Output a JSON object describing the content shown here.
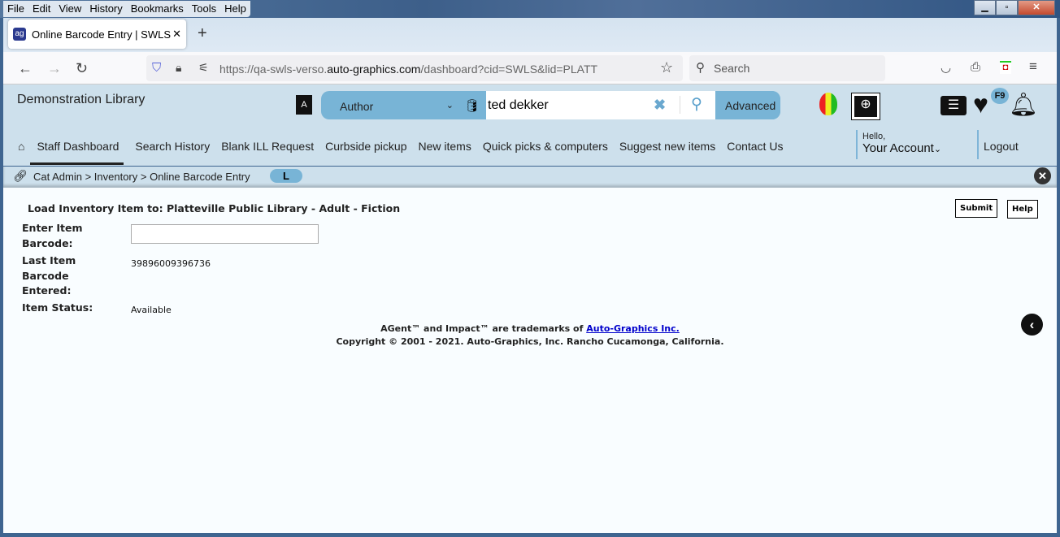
{
  "browser": {
    "menu": [
      "File",
      "Edit",
      "View",
      "History",
      "Bookmarks",
      "Tools",
      "Help"
    ],
    "tab_title": "Online Barcode Entry | SWLS | pl",
    "url_prefix": "https://qa-swls-verso.",
    "url_domain": "auto-graphics.com",
    "url_path": "/dashboard?cid=SWLS&lid=PLATT",
    "search_placeholder": "Search"
  },
  "app": {
    "library_name": "Demonstration Library",
    "search_type": "Author",
    "search_value": "ted dekker",
    "advanced_label": "Advanced",
    "badge": "F9",
    "nav": [
      "Staff Dashboard",
      "Search History",
      "Blank ILL Request",
      "Curbside pickup",
      "New items",
      "Quick picks & computers",
      "Suggest new items",
      "Contact Us"
    ],
    "hello": "Hello,",
    "account": "Your Account",
    "logout": "Logout"
  },
  "breadcrumb": {
    "text": "Cat Admin > Inventory > Online Barcode Entry",
    "pill": "L"
  },
  "form": {
    "heading": "Load Inventory Item to: Platteville Public Library - Adult - Fiction",
    "barcode_label_1": "Enter Item",
    "barcode_label_2": "Barcode:",
    "barcode_value": "",
    "last_label_1": "Last Item",
    "last_label_2": "Barcode",
    "last_label_3": "Entered:",
    "last_value": "39896009396736",
    "status_label": "Item Status:",
    "status_value": "Available",
    "submit": "Submit",
    "help": "Help"
  },
  "footer": {
    "trademark": "AGent™ and Impact™ are trademarks of ",
    "link": "Auto-Graphics Inc.",
    "copyright": "Copyright © 2001 - 2021. Auto-Graphics, Inc. Rancho Cucamonga, California."
  },
  "colors": {
    "header_bg": "#cde0ec",
    "accent": "#78b4d6"
  }
}
